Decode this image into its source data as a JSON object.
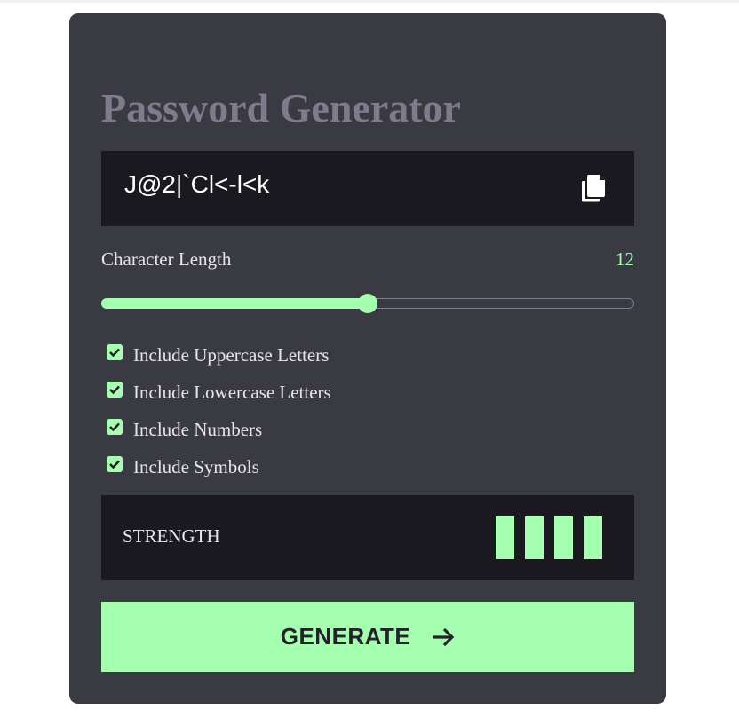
{
  "app": {
    "title": "Password Generator"
  },
  "password": {
    "value": "J@2|`Cl<-l<k",
    "copy_icon": "copy-icon"
  },
  "length": {
    "label": "Character Length",
    "value": "12",
    "slider_fraction": 0.5
  },
  "options": [
    {
      "label": "Include Uppercase Letters",
      "checked": true
    },
    {
      "label": "Include Lowercase Letters",
      "checked": true
    },
    {
      "label": "Include Numbers",
      "checked": true
    },
    {
      "label": "Include Symbols",
      "checked": true
    }
  ],
  "strength": {
    "label": "STRENGTH",
    "level": 4,
    "max_level": 4
  },
  "generate": {
    "label": "GENERATE",
    "icon": "arrow-right-icon"
  },
  "colors": {
    "accent": "#a4ffaf",
    "card_bg": "#3a3a43",
    "panel_bg": "#1a1920",
    "title": "#7d7b8c"
  }
}
